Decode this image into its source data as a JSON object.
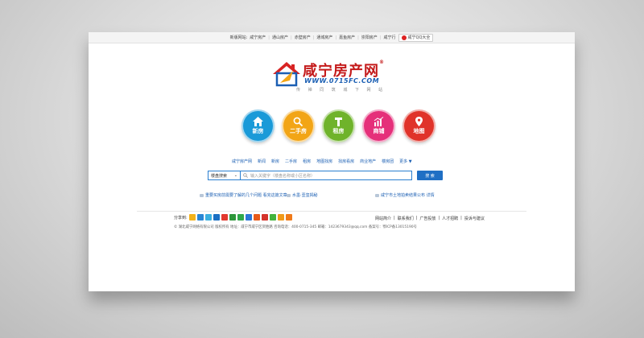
{
  "topbar": {
    "label": "新版网站:",
    "links": [
      "咸宁房产",
      "通山房产",
      "赤壁房产",
      "通城房产",
      "嘉鱼房产",
      "崇阳房产",
      "咸宁行"
    ],
    "qq_label": "咸宁QQ大全"
  },
  "logo": {
    "title": "咸宁房产网",
    "reg_mark": "®",
    "url": "WWW.0715FC.COM",
    "slogan": "传 禅 同 筑 城 下 网 站"
  },
  "circles": [
    {
      "label": "新房",
      "color": "#1a9ad8",
      "icon": "house-icon"
    },
    {
      "label": "二手房",
      "color": "#f2a516",
      "icon": "magnifier-icon"
    },
    {
      "label": "租房",
      "color": "#6fb32b",
      "icon": "key-icon"
    },
    {
      "label": "商铺",
      "color": "#e5307a",
      "icon": "chart-icon"
    },
    {
      "label": "地图",
      "color": "#e0332a",
      "icon": "map-pin-icon"
    }
  ],
  "nav": {
    "links": [
      "咸宁房产网",
      "新闻",
      "新房",
      "二手房",
      "租房",
      "地图找房",
      "找房看房",
      "商业地产",
      "楼房团"
    ],
    "more": "更多"
  },
  "search": {
    "select_value": "楼盘搜索",
    "placeholder": "输入关键字（楼盘名称或小区名称）",
    "button": "搜 索"
  },
  "news": {
    "left": "重要买房前需要了解的几个问题 看完这篇文章",
    "middle": "水墨·壹玺揭秘",
    "right": "咸宁市土地拍卖结果公布 详情"
  },
  "share": {
    "label": "分享到:",
    "icons": [
      {
        "name": "qzone-icon",
        "color": "#f3b21a"
      },
      {
        "name": "sina-weibo-icon",
        "color": "#2a86d4"
      },
      {
        "name": "tencent-weibo-icon",
        "color": "#3bb0e0"
      },
      {
        "name": "renren-icon",
        "color": "#1a6fc4"
      },
      {
        "name": "kaixin-icon",
        "color": "#e2382e"
      },
      {
        "name": "douban-icon",
        "color": "#2d963a"
      },
      {
        "name": "pengyou-icon",
        "color": "#2fa84a"
      },
      {
        "name": "baidu-icon",
        "color": "#2b77d8"
      },
      {
        "name": "taobao-icon",
        "color": "#e85a1a"
      },
      {
        "name": "163-icon",
        "color": "#d4332b"
      },
      {
        "name": "wechat-icon",
        "color": "#42b33c"
      },
      {
        "name": "sohu-icon",
        "color": "#f09a1a"
      },
      {
        "name": "more-share-icon",
        "color": "#f07a1a"
      }
    ]
  },
  "footer": {
    "links": [
      "网站简介",
      "联系我们",
      "广告投放",
      "人才招聘",
      "投诉与建议"
    ],
    "copyright": "© 湖北咸宁网络有限公司 版权所有  地址：咸宁市咸宁区贺胜路 咨询电话：400-0715-345  邮箱：1423679343@qq.com  备案号：鄂ICP备13015190号"
  }
}
